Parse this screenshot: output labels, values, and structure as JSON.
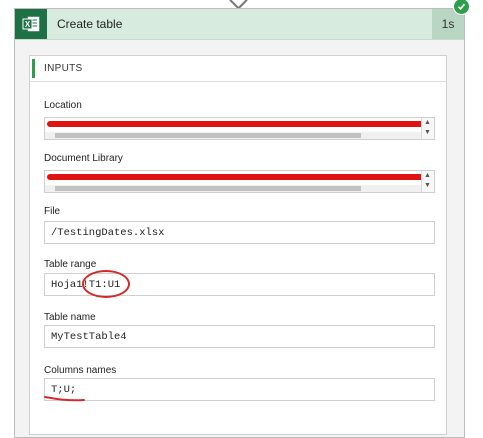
{
  "action": {
    "title": "Create table",
    "duration": "1s",
    "app_icon": "excel-icon",
    "status_icon": "check-icon",
    "accent_color": "#1e7145"
  },
  "inputs": {
    "heading": "INPUTS",
    "fields": {
      "location": {
        "label": "Location",
        "value": "",
        "redacted": true
      },
      "document_library": {
        "label": "Document Library",
        "value": "",
        "redacted": true
      },
      "file": {
        "label": "File",
        "value": "/TestingDates.xlsx"
      },
      "table_range": {
        "label": "Table range",
        "value": "Hoja1!T1:U1"
      },
      "table_name": {
        "label": "Table name",
        "value": "MyTestTable4"
      },
      "columns_names": {
        "label": "Columns names",
        "value": "T;U;"
      }
    }
  },
  "annotations": {
    "color": "#d42a2a"
  }
}
